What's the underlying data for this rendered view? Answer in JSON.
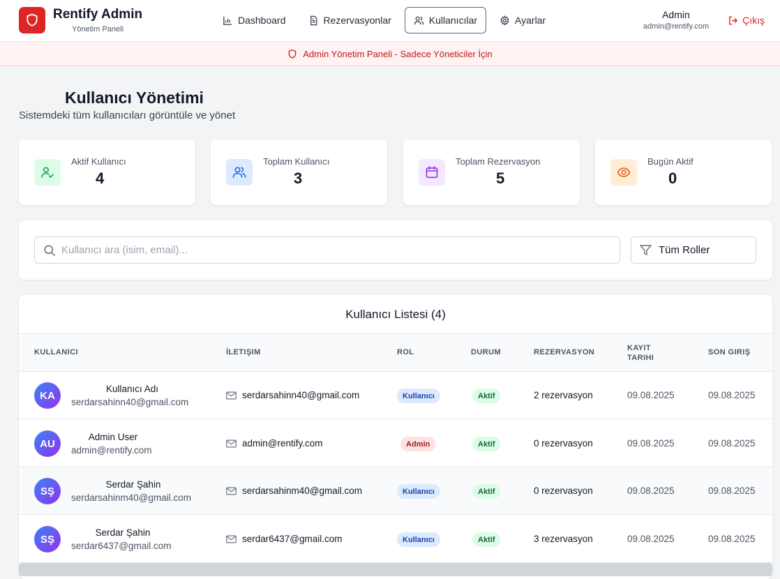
{
  "app": {
    "title": "Rentify Admin",
    "subtitle": "Yönetim Paneli"
  },
  "nav": {
    "items": [
      {
        "label": "Dashboard",
        "icon": "bar-chart-icon"
      },
      {
        "label": "Rezervasyonlar",
        "icon": "document-icon"
      },
      {
        "label": "Kullanıcılar",
        "icon": "users-icon",
        "active": true
      },
      {
        "label": "Ayarlar",
        "icon": "gear-icon"
      }
    ]
  },
  "user": {
    "name": "Admin",
    "email": "admin@rentify.com",
    "logout_label": "Çıkış"
  },
  "banner": {
    "text": "Admin Yönetim Paneli - Sadece Yöneticiler İçin"
  },
  "page": {
    "title": "Kullanıcı Yönetimi",
    "subtitle": "Sistemdeki tüm kullanıcıları görüntüle ve yönet"
  },
  "stats": [
    {
      "label": "Aktif Kullanıcı",
      "value": "4",
      "icon": "user-check-icon",
      "bg": "#dcfce7",
      "color": "#16a34a"
    },
    {
      "label": "Toplam Kullanıcı",
      "value": "3",
      "icon": "users-icon",
      "bg": "#dbeafe",
      "color": "#2563eb"
    },
    {
      "label": "Toplam Rezervasyon",
      "value": "5",
      "icon": "calendar-icon",
      "bg": "#f3e8ff",
      "color": "#9333ea"
    },
    {
      "label": "Bugün Aktif",
      "value": "0",
      "icon": "eye-icon",
      "bg": "#ffedd5",
      "color": "#ea580c"
    }
  ],
  "search": {
    "placeholder": "Kullanıcı ara (isim, email)...",
    "value": ""
  },
  "filter": {
    "label": "Tüm Roller"
  },
  "table": {
    "title": "Kullanıcı Listesi (4)",
    "columns": [
      "KULLANICI",
      "İLETIŞIM",
      "ROL",
      "DURUM",
      "REZERVASYON",
      "KAYIT TARIHI",
      "SON GIRIŞ"
    ],
    "rows": [
      {
        "initials": "KA",
        "name": "Kullanıcı Adı",
        "email": "serdarsahinn40@gmail.com",
        "contact": "serdarsahinn40@gmail.com",
        "role": "Kullanıcı",
        "status": "Aktif",
        "reservations": "2 rezervasyon",
        "registered": "09.08.2025",
        "last_login": "09.08.2025"
      },
      {
        "initials": "AU",
        "name": "Admin User",
        "email": "admin@rentify.com",
        "contact": "admin@rentify.com",
        "role": "Admin",
        "status": "Aktif",
        "reservations": "0 rezervasyon",
        "registered": "09.08.2025",
        "last_login": "09.08.2025"
      },
      {
        "initials": "SŞ",
        "name": "Serdar Şahin",
        "email": "serdarsahinm40@gmail.com",
        "contact": "serdarsahinm40@gmail.com",
        "role": "Kullanıcı",
        "status": "Aktif",
        "reservations": "0 rezervasyon",
        "registered": "09.08.2025",
        "last_login": "09.08.2025"
      },
      {
        "initials": "SŞ",
        "name": "Serdar Şahin",
        "email": "serdar6437@gmail.com",
        "contact": "serdar6437@gmail.com",
        "role": "Kullanıcı",
        "status": "Aktif",
        "reservations": "3 rezervasyon",
        "registered": "09.08.2025",
        "last_login": "09.08.2025"
      }
    ]
  },
  "colors": {
    "brand": "#dc2626",
    "accent": "#4b6b8f"
  }
}
